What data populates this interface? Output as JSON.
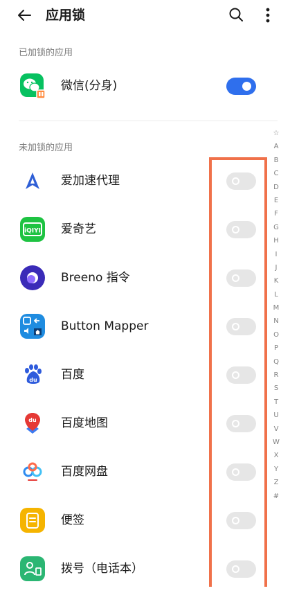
{
  "header": {
    "title": "应用锁"
  },
  "locked": {
    "section_label": "已加锁的应用",
    "items": [
      {
        "name": "微信(分身)",
        "icon": "wechat-clone-icon",
        "enabled": true
      }
    ]
  },
  "unlocked": {
    "section_label": "未加锁的应用",
    "items": [
      {
        "name": "爱加速代理",
        "icon": "ajiasu-icon",
        "enabled": false
      },
      {
        "name": "爱奇艺",
        "icon": "iqiyi-icon",
        "icon_text": "iQIYI",
        "enabled": false
      },
      {
        "name": "Breeno 指令",
        "icon": "breeno-icon",
        "enabled": false
      },
      {
        "name": "Button Mapper",
        "icon": "button-mapper-icon",
        "enabled": false
      },
      {
        "name": "百度",
        "icon": "baidu-paw-icon",
        "icon_text": "du",
        "enabled": false
      },
      {
        "name": "百度地图",
        "icon": "baidu-map-icon",
        "icon_text": "du",
        "enabled": false
      },
      {
        "name": "百度网盘",
        "icon": "baidu-netdisk-icon",
        "enabled": false
      },
      {
        "name": "便签",
        "icon": "notes-icon",
        "enabled": false
      },
      {
        "name": "拨号（电话本）",
        "icon": "dialer-icon",
        "enabled": false
      }
    ]
  },
  "alphabet_index": [
    "☆",
    "A",
    "B",
    "C",
    "D",
    "E",
    "F",
    "G",
    "H",
    "I",
    "J",
    "K",
    "L",
    "M",
    "N",
    "O",
    "P",
    "Q",
    "R",
    "S",
    "T",
    "U",
    "V",
    "W",
    "X",
    "Y",
    "Z",
    "#"
  ],
  "colors": {
    "toggle_on": "#2f6fed",
    "toggle_off": "#e6e6e6",
    "highlight": "#f0714a",
    "wechat": "#07c160"
  }
}
